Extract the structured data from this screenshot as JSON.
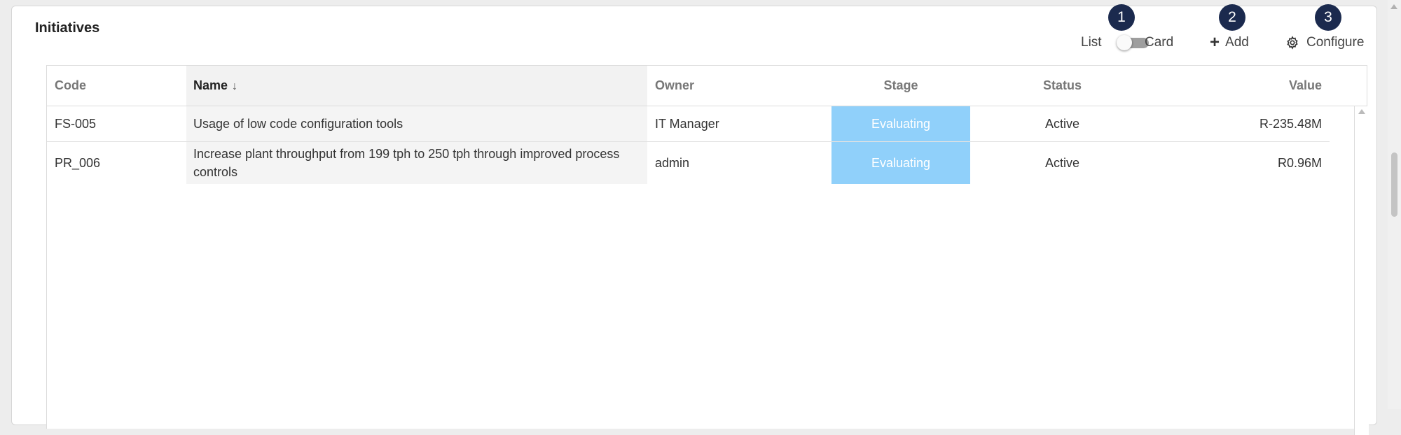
{
  "panel": {
    "title": "Initiatives"
  },
  "view_toggle": {
    "left_label": "List",
    "right_label": "Card",
    "state": "Card"
  },
  "toolbar": {
    "add_label": "Add",
    "configure_label": "Configure"
  },
  "badges": [
    "1",
    "2",
    "3"
  ],
  "table": {
    "columns": [
      "Code",
      "Name",
      "Owner",
      "Stage",
      "Status",
      "Value"
    ],
    "sort": {
      "column": "Name",
      "indicator": "↓"
    },
    "rows": [
      {
        "code": "FS-005",
        "name": "Usage of low code configuration tools",
        "owner": "IT Manager",
        "stage": "Evaluating",
        "status": "Active",
        "value": "R-235.48M"
      },
      {
        "code": "PR_006",
        "name": "Increase plant throughput from 199 tph to 250 tph through improved process controls",
        "owner": "admin",
        "stage": "Evaluating",
        "status": "Active",
        "value": "R0.96M"
      }
    ]
  },
  "colors": {
    "stage_bg": "#90d0fa",
    "badge_bg": "#1b2a4e",
    "header_selected_bg": "#f2f2f2"
  },
  "icons": {
    "add": "plus-icon",
    "configure": "gear-icon",
    "sort": "arrow-down-icon"
  }
}
